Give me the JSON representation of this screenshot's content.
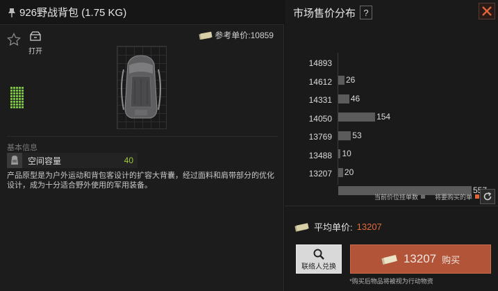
{
  "item": {
    "title": "926野战背包 (1.75 KG)",
    "open_label": "打开",
    "ref_price_label": "参考单价:10859",
    "section_label": "基本信息",
    "stat": {
      "label": "空间容量",
      "value": "40"
    },
    "description": "产品原型是为户外运动和背包客设计的扩容大背囊，经过面料和肩带部分的优化设计，成为十分适合野外使用的军用装备。",
    "capacity_cells_filled": 40
  },
  "market": {
    "title": "市场售价分布",
    "help_label": "?",
    "chart_data": {
      "type": "bar",
      "orientation": "horizontal",
      "categories": [
        "14893",
        "14612",
        "14331",
        "14050",
        "13769",
        "13488",
        "13207"
      ],
      "values": [
        null,
        26,
        46,
        154,
        53,
        10,
        20,
        557
      ],
      "series": [
        {
          "name": "当前价位挂单数",
          "values": [
            null,
            26,
            46,
            154,
            53,
            10,
            20,
            557
          ]
        }
      ],
      "xlim": [
        0,
        557
      ]
    },
    "legend": {
      "current_label": "当前价位挂单数",
      "current_color": "#6a6a6a",
      "buy_label": "将要购买的单",
      "buy_color": "#e0643a"
    },
    "avg_label": "平均单价:",
    "avg_value": "13207",
    "contact_label": "联络人兑换",
    "buy_price": "13207",
    "buy_label": "购买",
    "buy_note": "*购买后物品将被视为行动物资"
  },
  "colors": {
    "accent": "#b25438",
    "price_orange": "#e06a3c",
    "capacity_green": "#7bc23f"
  },
  "icons": {
    "pin": "pin-icon",
    "favorite": "star-icon",
    "open": "open-box-icon",
    "money": "banknote-icon",
    "close": "close-icon",
    "refresh": "refresh-icon",
    "search": "magnifier-icon",
    "stat": "backpack-icon"
  }
}
